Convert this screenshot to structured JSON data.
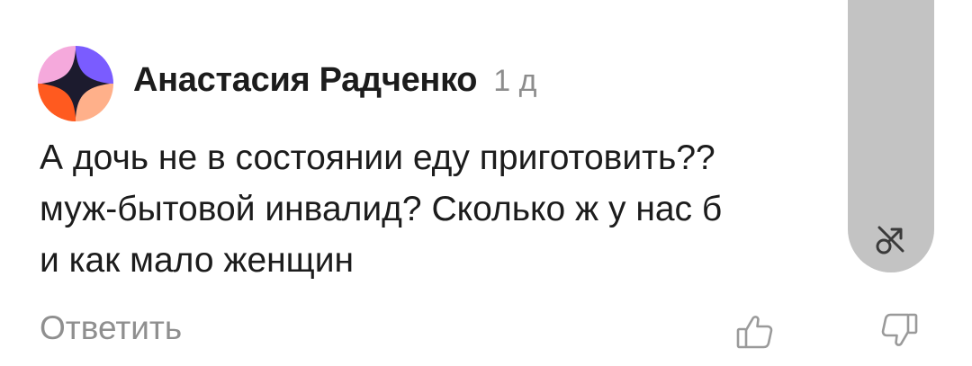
{
  "comment": {
    "author": "Анастасия Радченко",
    "time": "1 д",
    "lines": [
      "А дочь не в состоянии еду приготовить??",
      "муж-бытовой инвалид? Сколько ж у нас б",
      "и как мало женщин"
    ],
    "reply_label": "Ответить"
  },
  "icons": {
    "avatar": "avatar-icon",
    "like": "thumbs-up-icon",
    "dislike": "thumbs-down-icon",
    "pip": "pip-off-icon"
  },
  "colors": {
    "avatar_pink": "#f5a9dc",
    "avatar_purple": "#7a5cff",
    "avatar_orange": "#ff5a1f",
    "avatar_peach": "#ffb08a",
    "muted_text": "#8f8f8f",
    "panel": "#c3c3c3"
  }
}
